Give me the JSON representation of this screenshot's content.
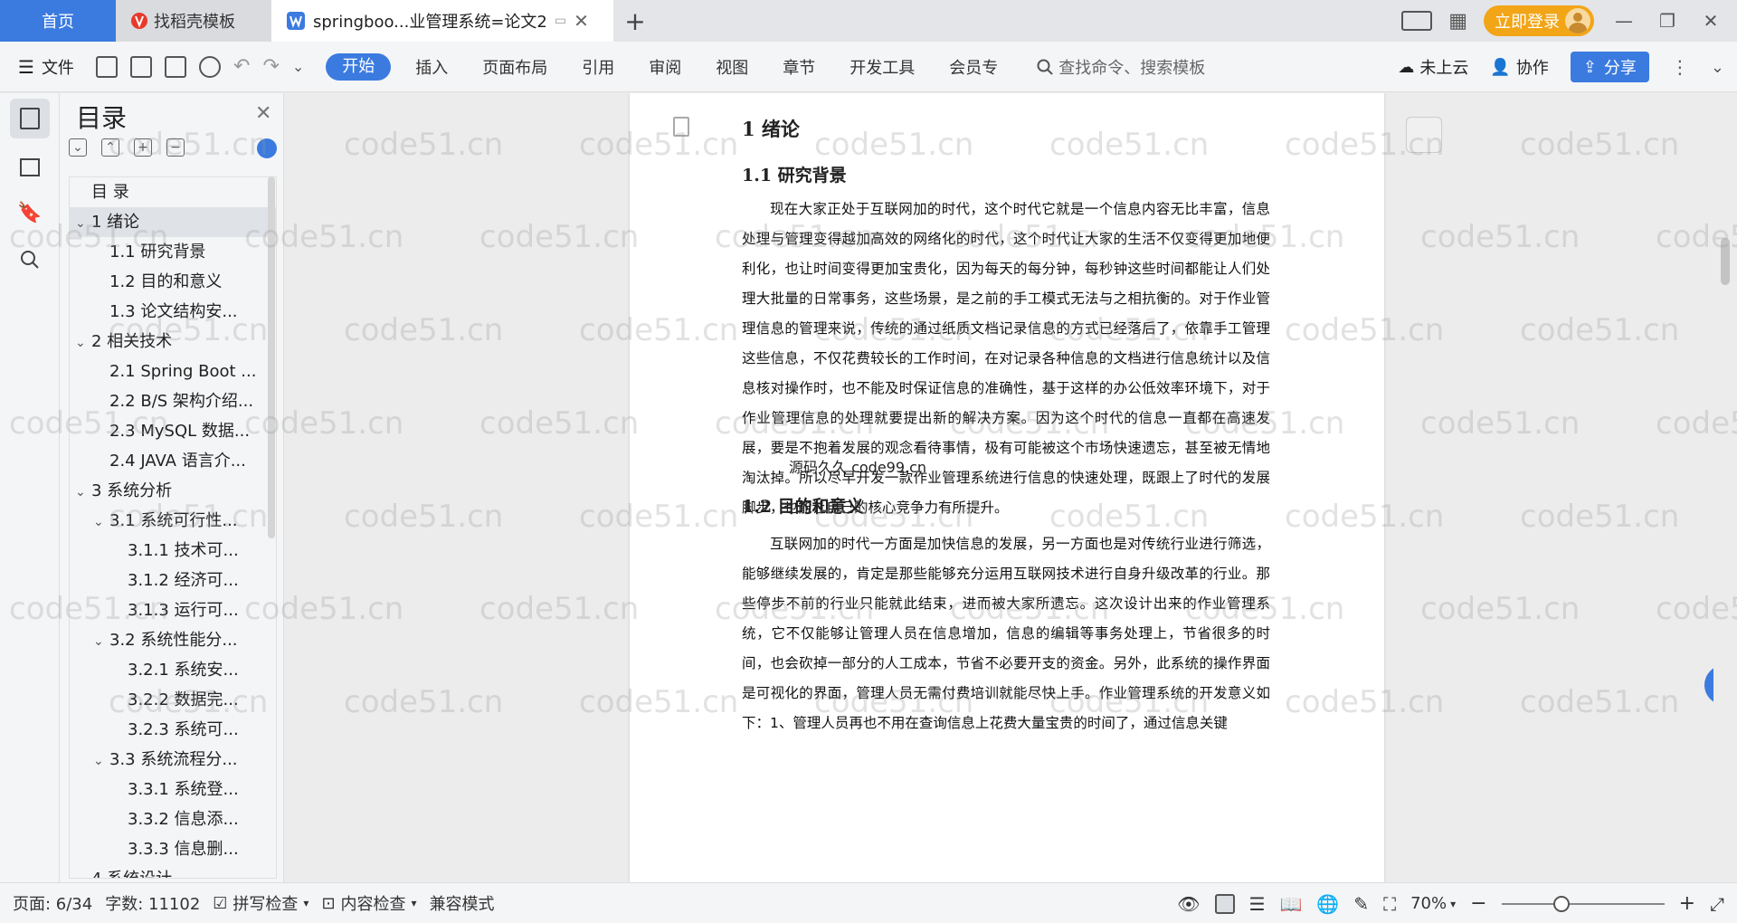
{
  "titlebar": {
    "tabs": [
      {
        "label": "首页"
      },
      {
        "label": "找稻壳模板"
      },
      {
        "label": "springboo...业管理系统=论文2"
      }
    ],
    "new_tab": "+",
    "login_label": "立即登录"
  },
  "ribbon": {
    "file_label": "文件",
    "tabs": [
      "开始",
      "插入",
      "页面布局",
      "引用",
      "审阅",
      "视图",
      "章节",
      "开发工具",
      "会员专"
    ],
    "search_placeholder": "查找命令、搜索模板",
    "cloud_label": "未上云",
    "collab_label": "协作",
    "share_label": "分享"
  },
  "toc": {
    "title": "目录",
    "items": [
      {
        "label": "目  录",
        "level": 1,
        "caret": ""
      },
      {
        "label": "1  绪论",
        "level": 1,
        "caret": "v"
      },
      {
        "label": "1.1  研究背景",
        "level": 2,
        "caret": ""
      },
      {
        "label": "1.2 目的和意义",
        "level": 2,
        "caret": ""
      },
      {
        "label": "1.3  论文结构安...",
        "level": 2,
        "caret": ""
      },
      {
        "label": "2  相关技术",
        "level": 1,
        "caret": "v"
      },
      {
        "label": "2.1 Spring Boot ...",
        "level": 2,
        "caret": ""
      },
      {
        "label": "2.2 B/S 架构介绍...",
        "level": 2,
        "caret": ""
      },
      {
        "label": "2.3 MySQL 数据...",
        "level": 2,
        "caret": ""
      },
      {
        "label": "2.4 JAVA 语言介...",
        "level": 2,
        "caret": ""
      },
      {
        "label": "3  系统分析",
        "level": 1,
        "caret": "v"
      },
      {
        "label": "3.1 系统可行性...",
        "level": 2,
        "caret": "v"
      },
      {
        "label": "3.1.1  技术可...",
        "level": 3,
        "caret": ""
      },
      {
        "label": "3.1.2  经济可...",
        "level": 3,
        "caret": ""
      },
      {
        "label": "3.1.3  运行可...",
        "level": 3,
        "caret": ""
      },
      {
        "label": "3.2 系统性能分...",
        "level": 2,
        "caret": "v"
      },
      {
        "label": "3.2.1  系统安...",
        "level": 3,
        "caret": ""
      },
      {
        "label": "3.2.2  数据完...",
        "level": 3,
        "caret": ""
      },
      {
        "label": "3.2.3 系统可...",
        "level": 3,
        "caret": ""
      },
      {
        "label": "3.3 系统流程分...",
        "level": 2,
        "caret": "v"
      },
      {
        "label": "3.3.1 系统登...",
        "level": 3,
        "caret": ""
      },
      {
        "label": "3.3.2 信息添...",
        "level": 3,
        "caret": ""
      },
      {
        "label": "3.3.3 信息删...",
        "level": 3,
        "caret": ""
      },
      {
        "label": "4  系统设计",
        "level": 1,
        "caret": "v"
      }
    ],
    "selected_index": 1
  },
  "document": {
    "h1": "1  绪论",
    "h2_1": "1.1  研究背景",
    "para_1": "现在大家正处于互联网加的时代，这个时代它就是一个信息内容无比丰富，信息处理与管理变得越加高效的网络化的时代，这个时代让大家的生活不仅变得更加地便利化，也让时间变得更加宝贵化，因为每天的每分钟，每秒钟这些时间都能让人们处理大批量的日常事务，这些场景，是之前的手工模式无法与之相抗衡的。对于作业管理信息的管理来说，传统的通过纸质文档记录信息的方式已经落后了，依靠手工管理这些信息，不仅花费较长的工作时间，在对记录各种信息的文档进行信息统计以及信息核对操作时，也不能及时保证信息的准确性，基于这样的办公低效率环境下，对于作业管理信息的处理就要提出新的解决方案。因为这个时代的信息一直都在高速发展，要是不抱着发展的观念看待事情，极有可能被这个市场快速遗忘，甚至被无情地淘汰掉。所以尽早开发一款作业管理系统进行信息的快速处理，既跟上了时代的发展脚步，也能让自己的核心竞争力有所提升。",
    "overlay_note": "源码久久 code99.cn",
    "h2_2": "1.2 目的和意义",
    "para_2": "互联网加的时代一方面是加快信息的发展，另一方面也是对传统行业进行筛选，能够继续发展的，肯定是那些能够充分运用互联网技术进行自身升级改革的行业。那些停步不前的行业只能就此结束，进而被大家所遗忘。这次设计出来的作业管理系统，它不仅能够让管理人员在信息增加，信息的编辑等事务处理上，节省很多的时间，也会砍掉一部分的人工成本，节省不必要开支的资金。另外，此系统的操作界面是可视化的界面，管理人员无需付费培训就能尽快上手。作业管理系统的开发意义如下：",
    "para_3": "1、管理人员再也不用在查询信息上花费大量宝贵的时间了，通过信息关键"
  },
  "watermark": "code51.cn",
  "status": {
    "page": "页面: 6/34",
    "words": "字数: 11102",
    "spellcheck": "拼写检查",
    "content_check": "内容检查",
    "compat_mode": "兼容模式",
    "zoom": "70%",
    "zoom_level_percent": 70
  },
  "colors": {
    "accent": "#3b7be0",
    "login": "#f2a516"
  }
}
